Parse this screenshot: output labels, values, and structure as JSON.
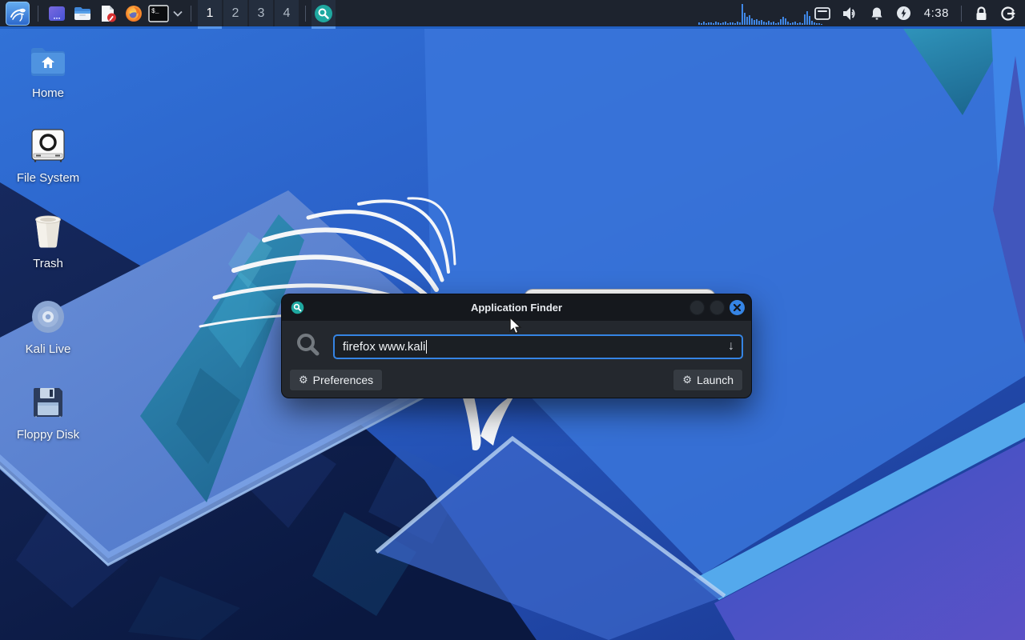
{
  "panel": {
    "clock": "4:38",
    "workspaces": {
      "items": [
        "1",
        "2",
        "3",
        "4"
      ],
      "active_index": 0
    },
    "launcher_icon_names": [
      "kali-menu",
      "window-manager",
      "file-manager",
      "text-editor",
      "firefox",
      "terminal",
      "terminal-dropdown"
    ],
    "tray_icon_names": [
      "cpu-graph",
      "display",
      "volume",
      "notifications",
      "power-manager",
      "lock-screen",
      "logout"
    ],
    "terminal_glyph": "$_",
    "graph_bars": [
      3,
      2,
      4,
      2,
      3,
      3,
      2,
      4,
      3,
      2,
      3,
      4,
      2,
      3,
      3,
      2,
      4,
      3,
      26,
      15,
      10,
      12,
      8,
      6,
      7,
      5,
      6,
      4,
      3,
      5,
      3,
      4,
      2,
      3,
      7,
      10,
      8,
      4,
      2,
      3,
      4,
      2,
      3,
      2,
      13,
      17,
      11,
      5,
      3,
      2,
      2,
      1
    ]
  },
  "desktop": {
    "icons": [
      {
        "name": "home",
        "label": "Home"
      },
      {
        "name": "file-system",
        "label": "File System"
      },
      {
        "name": "trash",
        "label": "Trash"
      },
      {
        "name": "kali-live",
        "label": "Kali Live"
      },
      {
        "name": "floppy-disk",
        "label": "Floppy Disk"
      }
    ]
  },
  "finder": {
    "title": "Application Finder",
    "search": {
      "value": "firefox www.kali",
      "dropdown_glyph": "↓"
    },
    "buttons": {
      "preferences": "Preferences",
      "launch": "Launch"
    },
    "gear_glyph": "⚙"
  },
  "colors": {
    "accent_blue": "#3584e4",
    "panel_bg": "#1d232e",
    "panel_underline": "#5695ea",
    "appfinder_teal": "#1fa8a0",
    "wallpaper_navy": "#0c1c48",
    "wallpaper_purple": "#5b51c6"
  }
}
